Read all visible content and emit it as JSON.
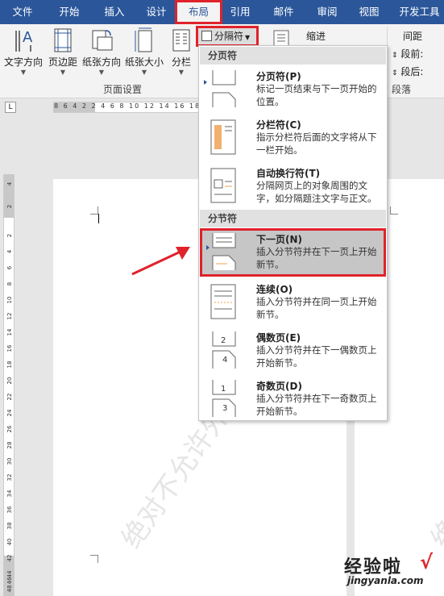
{
  "tabs": [
    {
      "label": "文件"
    },
    {
      "label": "开始"
    },
    {
      "label": "插入"
    },
    {
      "label": "设计"
    },
    {
      "label": "布局"
    },
    {
      "label": "引用"
    },
    {
      "label": "邮件"
    },
    {
      "label": "审阅"
    },
    {
      "label": "视图"
    },
    {
      "label": "开发工具"
    }
  ],
  "ribbon": {
    "text_direction": "文字方向",
    "margins": "页边距",
    "orientation": "纸张方向",
    "size": "纸张大小",
    "columns": "分栏",
    "breaks": "分隔符",
    "group_page_setup": "页面设置",
    "indent": "缩进",
    "spacing": "间距",
    "before": "段前:",
    "after": "段后:",
    "group_paragraph": "段落"
  },
  "ruler": {
    "corner": "L",
    "numbers": "8 6 4 2  2 4 6 8 10 12 14 16 18"
  },
  "vruler": [
    "4",
    "2",
    "2",
    "4",
    "6",
    "8",
    "10",
    "12",
    "14",
    "16",
    "18",
    "20",
    "22",
    "24",
    "26",
    "28",
    "30",
    "32",
    "34",
    "36",
    "38",
    "40",
    "42",
    "44",
    "46",
    "48"
  ],
  "menu": {
    "section_page": "分页符",
    "section_section": "分节符",
    "items": [
      {
        "title": "分页符(P)",
        "desc": "标记一页结束与下一页开始的位置。"
      },
      {
        "title": "分栏符(C)",
        "desc": "指示分栏符后面的文字将从下一栏开始。"
      },
      {
        "title": "自动换行符(T)",
        "desc": "分隔网页上的对象周围的文字，如分隔题注文字与正文。"
      },
      {
        "title": "下一页(N)",
        "desc": "插入分节符并在下一页上开始新节。"
      },
      {
        "title": "连续(O)",
        "desc": "插入分节符并在同一页上开始新节。"
      },
      {
        "title": "偶数页(E)",
        "desc": "插入分节符并在下一偶数页上开始新节。"
      },
      {
        "title": "奇数页(D)",
        "desc": "插入分节符并在下一奇数页上开始新节。"
      }
    ]
  },
  "watermark": "绝对不允许外传",
  "logo": {
    "name": "经验啦",
    "check": "√",
    "url": "jingyanla.com"
  },
  "colors": {
    "accent": "#2b579a",
    "highlight": "#e0222b"
  }
}
